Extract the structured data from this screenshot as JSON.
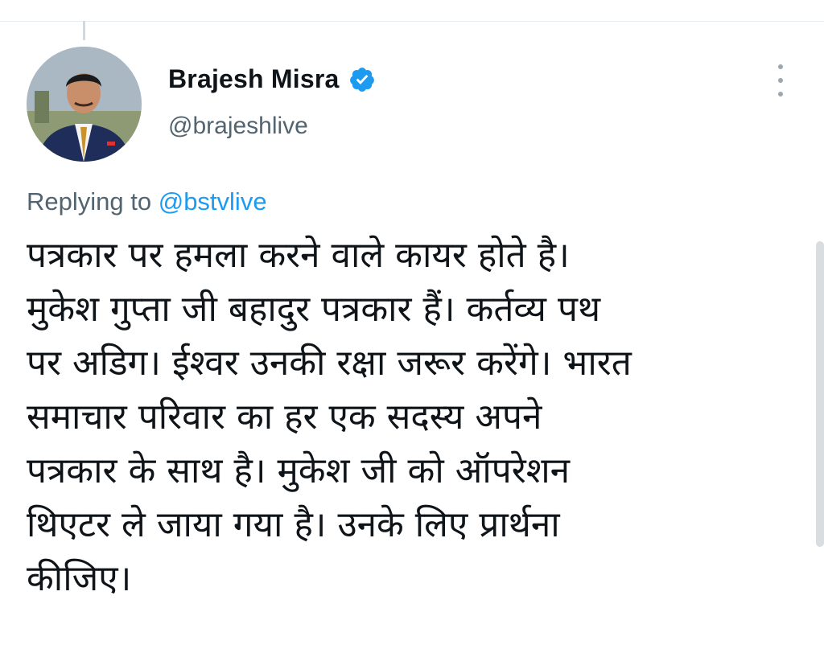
{
  "tweet": {
    "author": {
      "display_name": "Brajesh Misra",
      "handle": "@brajeshlive",
      "verified": true,
      "verified_icon": "verified-badge-icon",
      "verified_color": "#1d9bf0"
    },
    "reply": {
      "prefix": "Replying to",
      "handle": "@bstvlive",
      "handle_color": "#1d9bf0"
    },
    "text": "पत्रकार पर हमला करने वाले कायर होते है।\nमुकेश गुप्ता जी बहादुर पत्रकार हैं। कर्तव्य पथ\nपर अडिग। ईश्वर उनकी रक्षा जरूर करेंगे। भारत\nसमाचार परिवार का हर एक सदस्य अपने\nपत्रकार के साथ है। मुकेश जी को ऑपरेशन\nथिएटर ले जाया गया है। उनके लिए प्रार्थना\nकीजिए।",
    "more_icon": "more-vertical-icon"
  }
}
